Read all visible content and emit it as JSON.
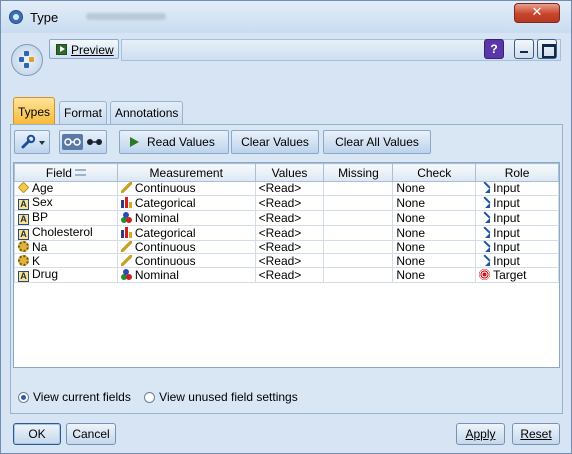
{
  "window": {
    "title": "Type"
  },
  "toolbar": {
    "preview_label": "Preview",
    "help_label": "?"
  },
  "tabs": [
    {
      "label": "Types",
      "active": true
    },
    {
      "label": "Format",
      "active": false
    },
    {
      "label": "Annotations",
      "active": false
    }
  ],
  "actions": {
    "read_values": "Read Values",
    "clear_values": "Clear Values",
    "clear_all_values": "Clear All Values"
  },
  "table": {
    "columns": [
      "Field",
      "Measurement",
      "Values",
      "Missing",
      "Check",
      "Role"
    ],
    "rows": [
      {
        "field": "Age",
        "field_icon": "continuous-field-icon",
        "measurement": "Continuous",
        "measurement_icon": "continuous-icon",
        "values": "<Read>",
        "missing": "",
        "check": "None",
        "role": "Input",
        "role_icon": "input-arrow-icon"
      },
      {
        "field": "Sex",
        "field_icon": "string-field-icon",
        "measurement": "Categorical",
        "measurement_icon": "categorical-icon",
        "values": "<Read>",
        "missing": "",
        "check": "None",
        "role": "Input",
        "role_icon": "input-arrow-icon"
      },
      {
        "field": "BP",
        "field_icon": "string-field-icon",
        "measurement": "Nominal",
        "measurement_icon": "nominal-icon",
        "values": "<Read>",
        "missing": "",
        "check": "None",
        "role": "Input",
        "role_icon": "input-arrow-icon"
      },
      {
        "field": "Cholesterol",
        "field_icon": "string-field-icon",
        "measurement": "Categorical",
        "measurement_icon": "categorical-icon",
        "values": "<Read>",
        "missing": "",
        "check": "None",
        "role": "Input",
        "role_icon": "input-arrow-icon"
      },
      {
        "field": "Na",
        "field_icon": "real-field-icon",
        "measurement": "Continuous",
        "measurement_icon": "continuous-icon",
        "values": "<Read>",
        "missing": "",
        "check": "None",
        "role": "Input",
        "role_icon": "input-arrow-icon"
      },
      {
        "field": "K",
        "field_icon": "real-field-icon",
        "measurement": "Continuous",
        "measurement_icon": "continuous-icon",
        "values": "<Read>",
        "missing": "",
        "check": "None",
        "role": "Input",
        "role_icon": "input-arrow-icon"
      },
      {
        "field": "Drug",
        "field_icon": "string-field-icon",
        "measurement": "Nominal",
        "measurement_icon": "nominal-icon",
        "values": "<Read>",
        "missing": "",
        "check": "None",
        "role": "Target",
        "role_icon": "target-icon"
      }
    ]
  },
  "view_options": [
    {
      "label": "View current fields",
      "selected": true
    },
    {
      "label": "View unused field settings",
      "selected": false
    }
  ],
  "buttons": {
    "ok": "OK",
    "cancel": "Cancel",
    "apply": "Apply",
    "reset": "Reset"
  },
  "colors": {
    "active_tab": "#f6b936",
    "window_bg": "#d6e4f3",
    "close": "#c8452c"
  }
}
